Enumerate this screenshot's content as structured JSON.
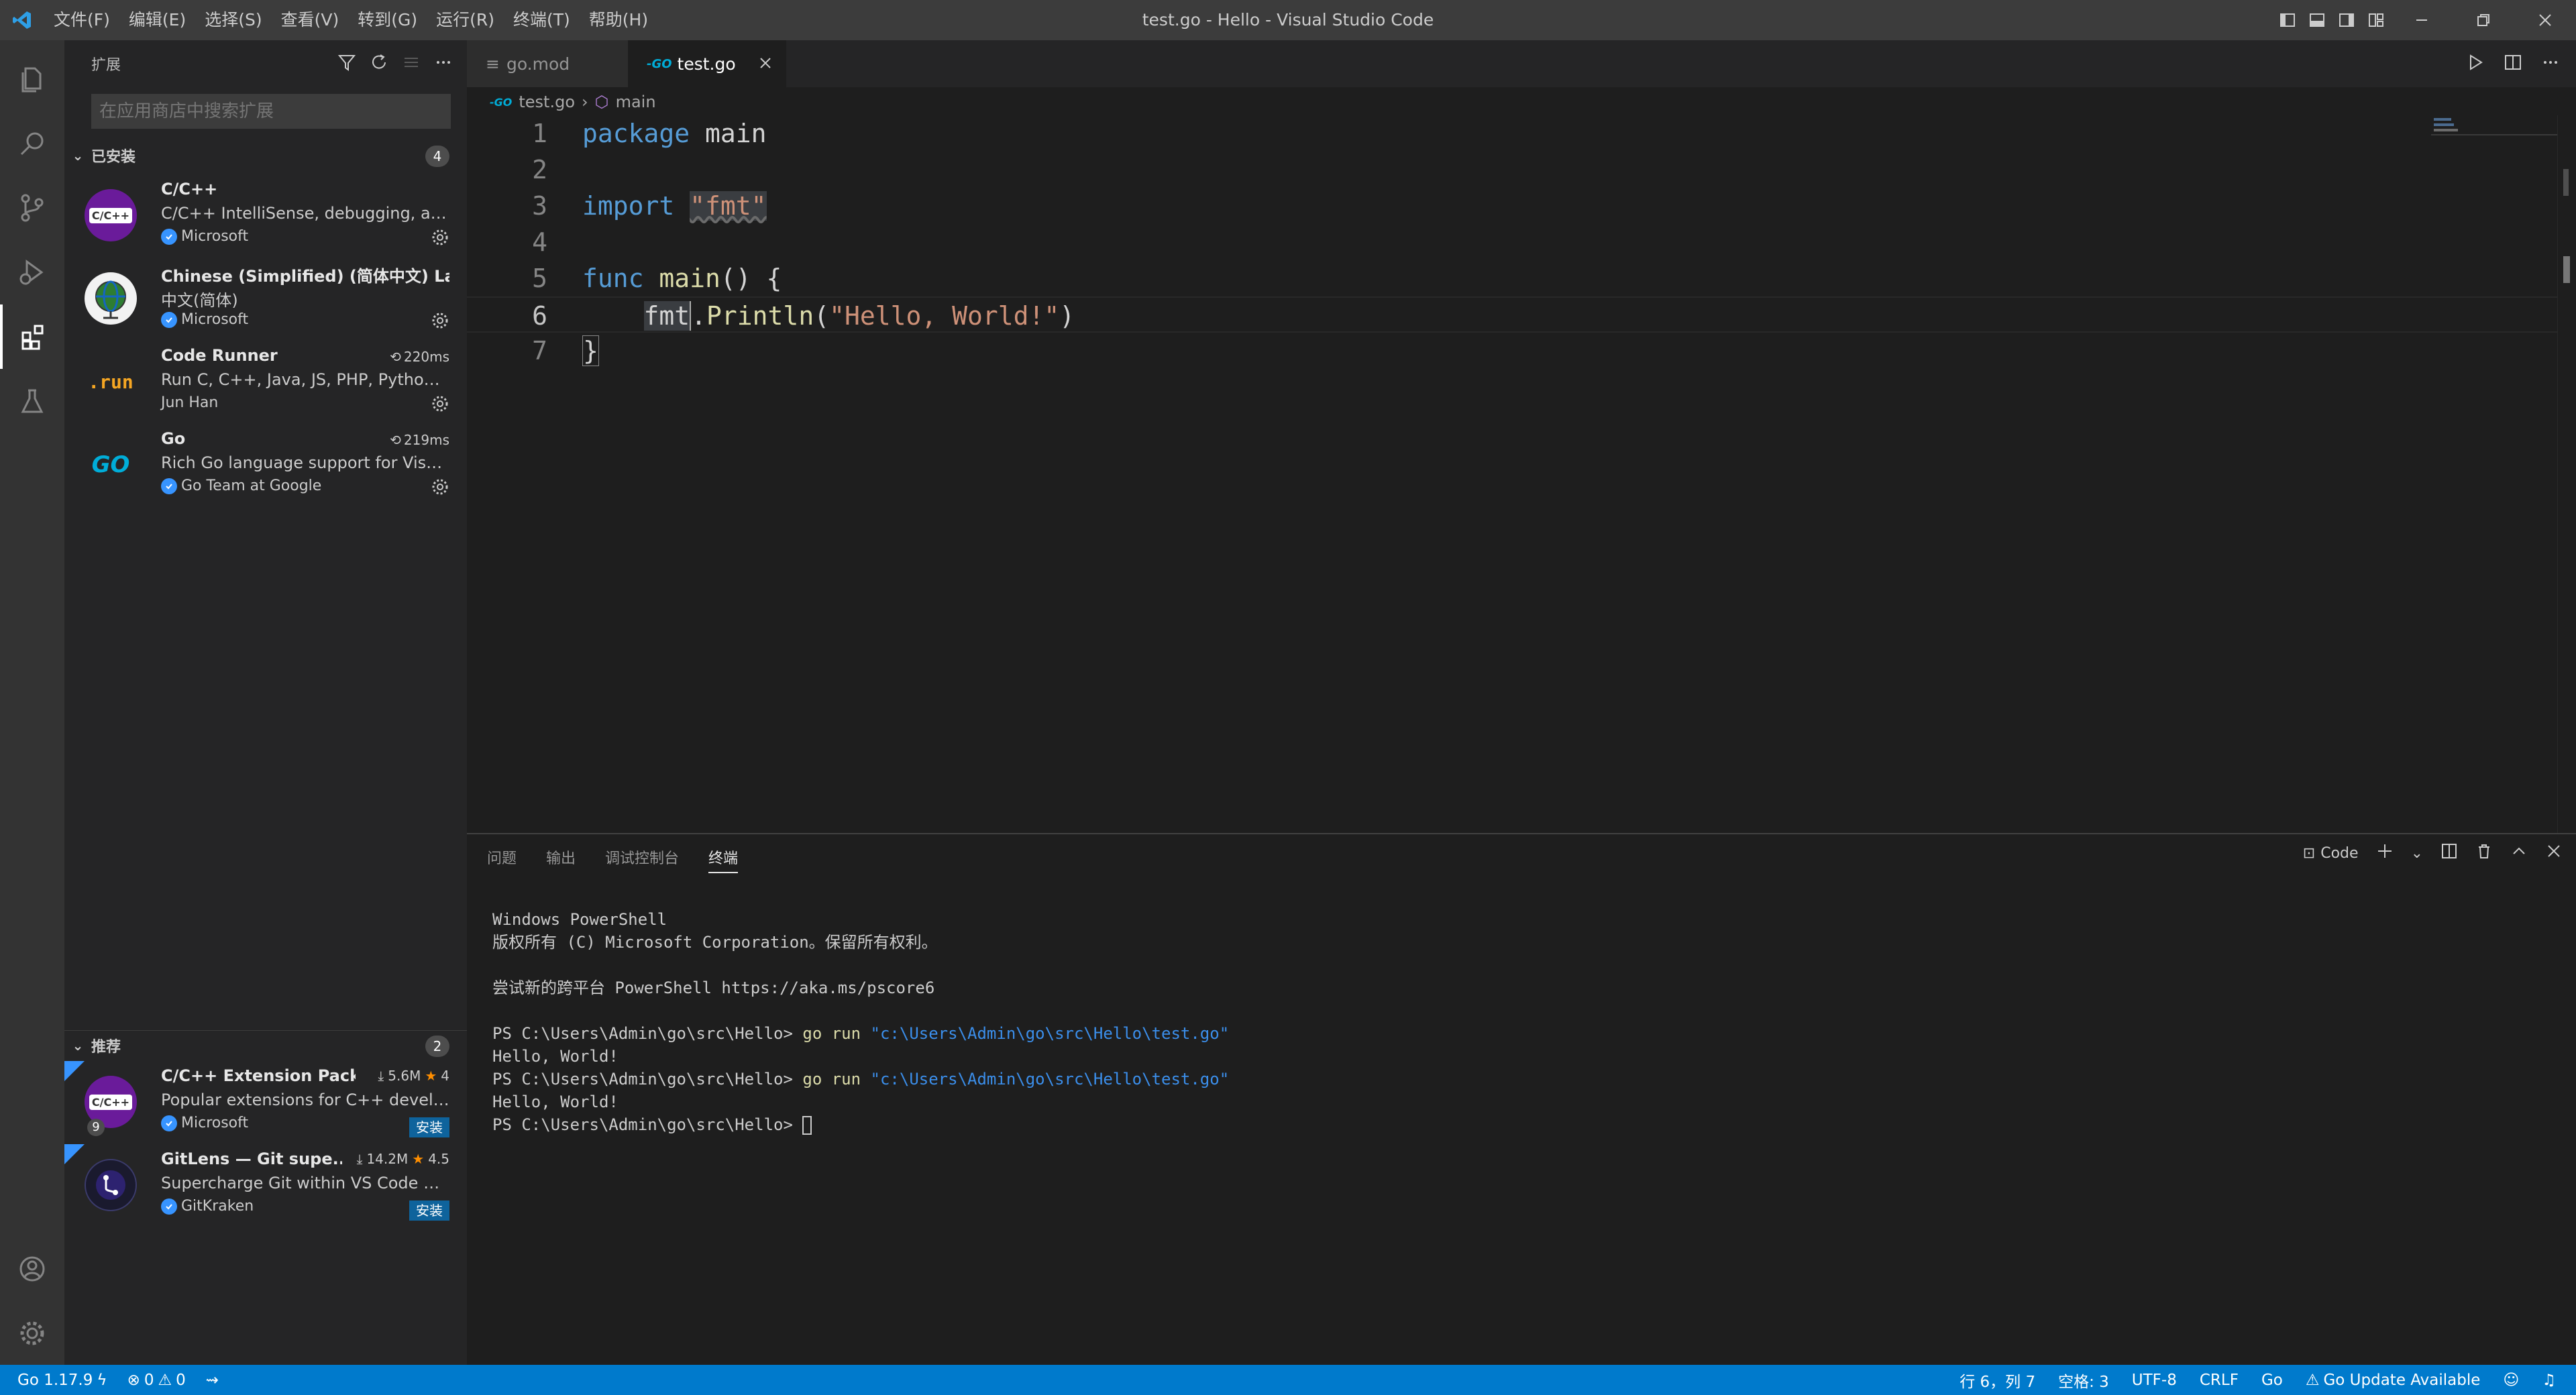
{
  "titlebar": {
    "title": "test.go - Hello - Visual Studio Code",
    "menu": [
      "文件(F)",
      "编辑(E)",
      "选择(S)",
      "查看(V)",
      "转到(G)",
      "运行(R)",
      "终端(T)",
      "帮助(H)"
    ]
  },
  "sidebar": {
    "header": "扩展",
    "search_placeholder": "在应用商店中搜索扩展",
    "installed": {
      "label": "已安装",
      "count": "4",
      "items": [
        {
          "name": "C/C++",
          "desc": "C/C++ IntelliSense, debugging, and...",
          "publisher": "Microsoft",
          "icon_text": "C/C++",
          "time": ""
        },
        {
          "name": "Chinese (Simplified) (简体中文) La...",
          "desc": "中文(简体)",
          "publisher": "Microsoft",
          "icon_text": "",
          "time": ""
        },
        {
          "name": "Code Runner",
          "desc": "Run C, C++, Java, JS, PHP, Python, P...",
          "publisher": "Jun Han",
          "icon_text": ".run",
          "time": "220ms"
        },
        {
          "name": "Go",
          "desc": "Rich Go language support for Visual...",
          "publisher": "Go Team at Google",
          "icon_text": "GO",
          "time": "219ms"
        }
      ]
    },
    "recommended": {
      "label": "推荐",
      "count": "2",
      "items": [
        {
          "name": "C/C++ Extension Pack",
          "desc": "Popular extensions for C++ develop...",
          "publisher": "Microsoft",
          "icon_text": "C/C++",
          "downloads": "5.6M",
          "rating": "4",
          "install_label": "安装",
          "pack_count": "9"
        },
        {
          "name": "GitLens — Git supe...",
          "desc": "Supercharge Git within VS Code — ...",
          "publisher": "GitKraken",
          "icon_text": "",
          "downloads": "14.2M",
          "rating": "4.5",
          "install_label": "安装"
        }
      ]
    }
  },
  "tabs": [
    {
      "label": "go.mod",
      "active": false
    },
    {
      "label": "test.go",
      "active": true
    }
  ],
  "breadcrumb": {
    "file": "test.go",
    "symbol": "main"
  },
  "editor": {
    "lines": [
      {
        "n": "1"
      },
      {
        "n": "2"
      },
      {
        "n": "3"
      },
      {
        "n": "4"
      },
      {
        "n": "5"
      },
      {
        "n": "6"
      },
      {
        "n": "7"
      }
    ],
    "code": {
      "l1_kw": "package",
      "l1_rest": " main",
      "l3_kw": "import",
      "l3_str": "\"fmt\"",
      "l5_kw": "func",
      "l5_fn": "main",
      "l5_rest": "() {",
      "l6_indent": "    ",
      "l6_pkg": "fmt",
      "l6_dot": ".",
      "l6_fn": "Println",
      "l6_open": "(",
      "l6_str": "\"Hello, World!\"",
      "l6_close": ")",
      "l7": "}"
    }
  },
  "panel": {
    "tabs": [
      "问题",
      "输出",
      "调试控制台",
      "终端"
    ],
    "active_tab": "终端",
    "terminal_name": "Code",
    "terminal": {
      "line1": "Windows PowerShell",
      "line2": "版权所有 (C) Microsoft Corporation。保留所有权利。",
      "line3": "尝试新的跨平台 PowerShell https://aka.ms/pscore6",
      "prompt": "PS C:\\Users\\Admin\\go\\src\\Hello> ",
      "cmd": "go run",
      "arg": "\"c:\\Users\\Admin\\go\\src\\Hello\\test.go\"",
      "output": "Hello, World!"
    }
  },
  "statusbar": {
    "go_version": "Go 1.17.9",
    "errors": "0",
    "warnings": "0",
    "position": "行 6，列 7",
    "spaces": "空格: 3",
    "encoding": "UTF-8",
    "eol": "CRLF",
    "language": "Go",
    "update": "Go Update Available"
  },
  "colors": {
    "accent": "#007acc",
    "keyword": "#569cd6",
    "string": "#ce9178",
    "function": "#dcdcaa"
  }
}
